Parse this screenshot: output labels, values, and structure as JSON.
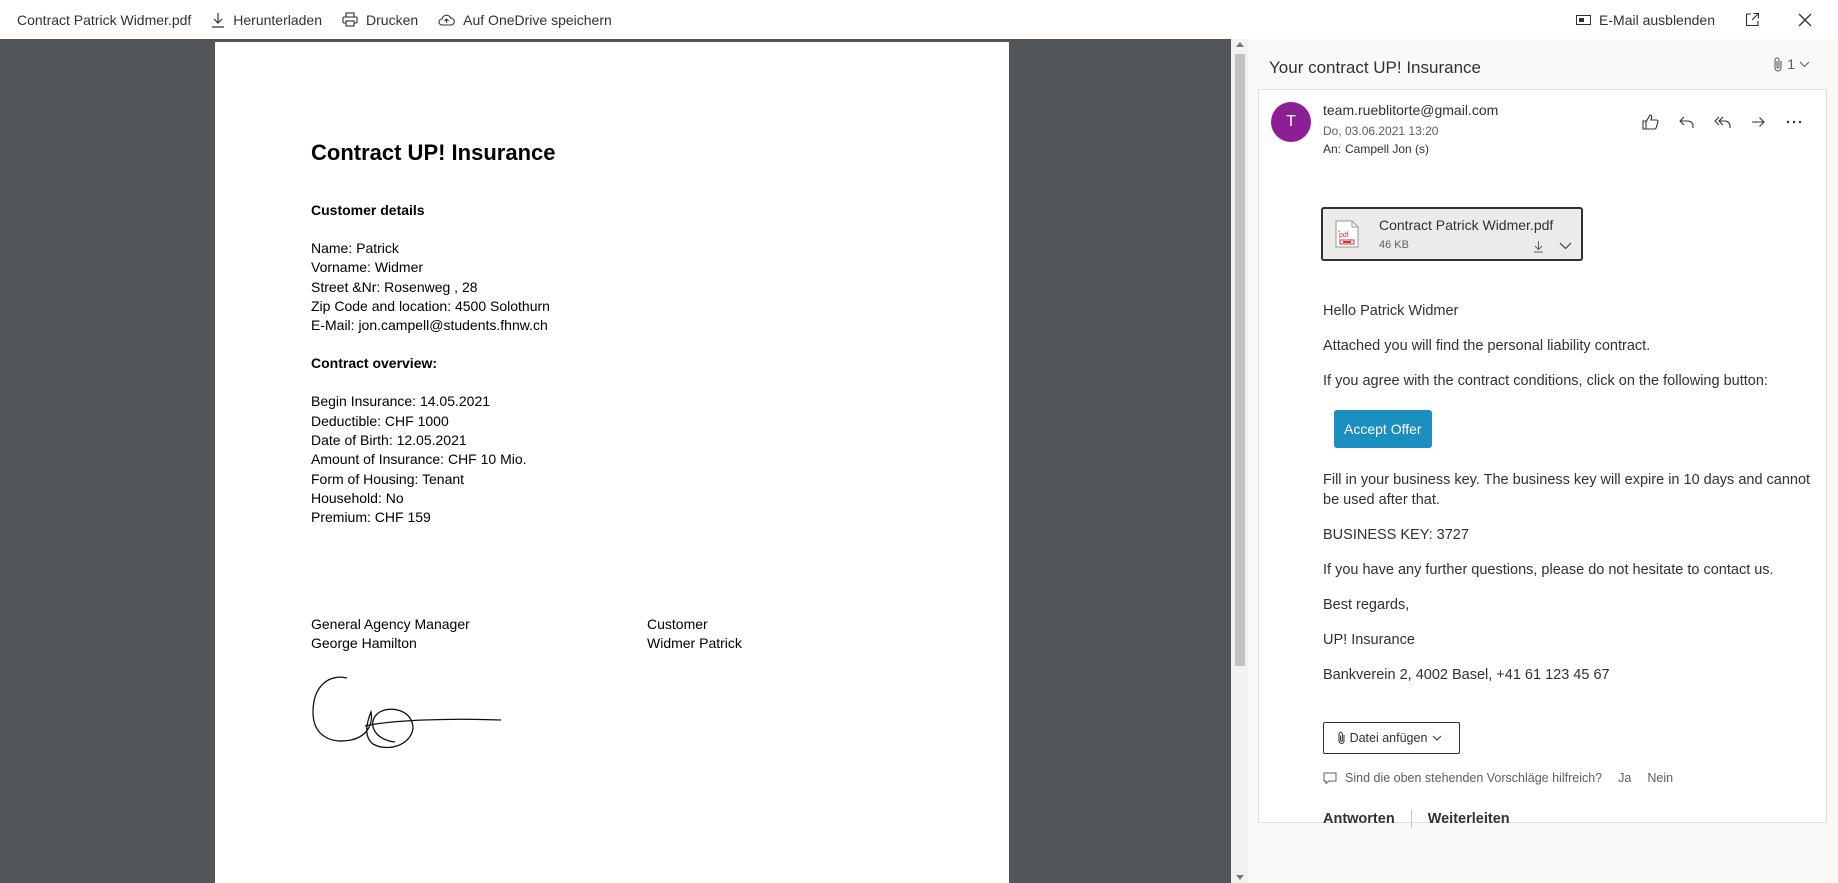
{
  "toolbar": {
    "filename": "Contract Patrick Widmer.pdf",
    "download": "Herunterladen",
    "print": "Drucken",
    "onedrive": "Auf OneDrive speichern",
    "hide_mail": "E-Mail ausblenden"
  },
  "pdf": {
    "title": "Contract UP! Insurance",
    "customer_heading": "Customer details",
    "customer_lines": [
      "Name: Patrick",
      "Vorname: Widmer",
      "Street &Nr: Rosenweg , 28",
      "Zip Code and location: 4500 Solothurn",
      "E-Mail: jon.campell@students.fhnw.ch"
    ],
    "contract_heading": "Contract overview:",
    "contract_lines": [
      "Begin Insurance: 14.05.2021",
      "Deductible: CHF 1000",
      "Date of Birth: 12.05.2021",
      "Amount of Insurance: CHF 10 Mio.",
      "Form of Housing: Tenant",
      "Household: No",
      "Premium: CHF 159"
    ],
    "sig_left_role": "General Agency Manager",
    "sig_left_name": "George Hamilton",
    "sig_right_role": "Customer",
    "sig_right_name": "Widmer Patrick"
  },
  "mail": {
    "subject": "Your contract UP! Insurance",
    "attachment_count": "1",
    "avatar_letter": "T",
    "from": "team.rueblitorte@gmail.com",
    "date": "Do, 03.06.2021 13:20",
    "to_label": "An:",
    "to": "Campell Jon (s)",
    "attachment": {
      "name": "Contract Patrick Widmer.pdf",
      "size": "46 KB"
    },
    "greeting": "Hello Patrick Widmer",
    "line1": "Attached you will find the personal liability contract.",
    "line2": "If you agree with the contract conditions, click on the following button:",
    "accept_button": "Accept Offer",
    "line3": "Fill in your business key. The business key will expire in 10 days and cannot be used after that.",
    "business_key": "BUSINESS KEY: 3727",
    "line4": "If you have any further questions, please do not hesitate to contact us.",
    "regards": "Best regards,",
    "company": "UP! Insurance",
    "address": "Bankverein 2, 4002 Basel, +41 61 123 45 67",
    "file_attach": "Datei anfügen",
    "feedback_q": "Sind die oben stehenden Vorschläge hilfreich?",
    "feedback_yes": "Ja",
    "feedback_no": "Nein",
    "reply": "Antworten",
    "forward": "Weiterleiten"
  },
  "colors": {
    "viewer_bg": "#525659",
    "avatar": "#8d1f94",
    "accept_button": "#1b8fc0"
  }
}
